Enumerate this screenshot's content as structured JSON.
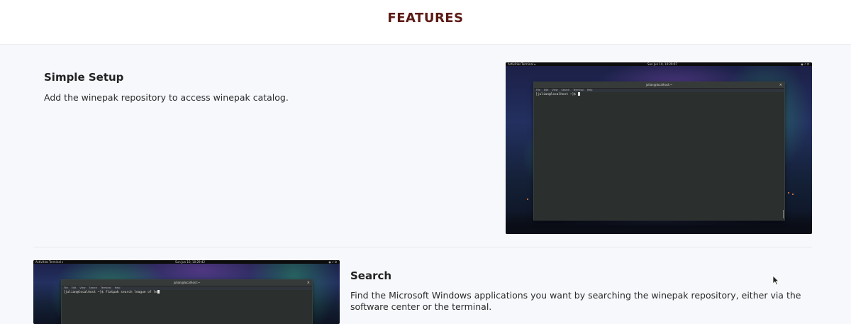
{
  "header": {
    "title": "FEATURES"
  },
  "features": [
    {
      "title": "Simple Setup",
      "description": "Add the winepak repository to access winepak catalog.",
      "screenshot": {
        "topbar": {
          "activities": "Activities",
          "app_menu": "Terminal ▾",
          "clock": "Sun Jun 10, 10:29:07"
        },
        "terminal": {
          "window_title": "julian@localhost:~",
          "menu": [
            "File",
            "Edit",
            "View",
            "Search",
            "Terminal",
            "Help"
          ],
          "prompt": "[julian@localhost ~]$ "
        }
      }
    },
    {
      "title": "Search",
      "description": "Find the Microsoft Windows applications you want by searching the winepak repository, either via the software center or the terminal.",
      "screenshot": {
        "topbar": {
          "activities": "Activities",
          "app_menu": "Terminal ▾",
          "clock": "Sun Jun 10, 10:29:42"
        },
        "terminal": {
          "window_title": "julian@localhost:~",
          "menu": [
            "File",
            "Edit",
            "View",
            "Search",
            "Terminal",
            "Help"
          ],
          "prompt": "[julian@localhost ~]$ flatpak search league of le"
        }
      }
    }
  ]
}
